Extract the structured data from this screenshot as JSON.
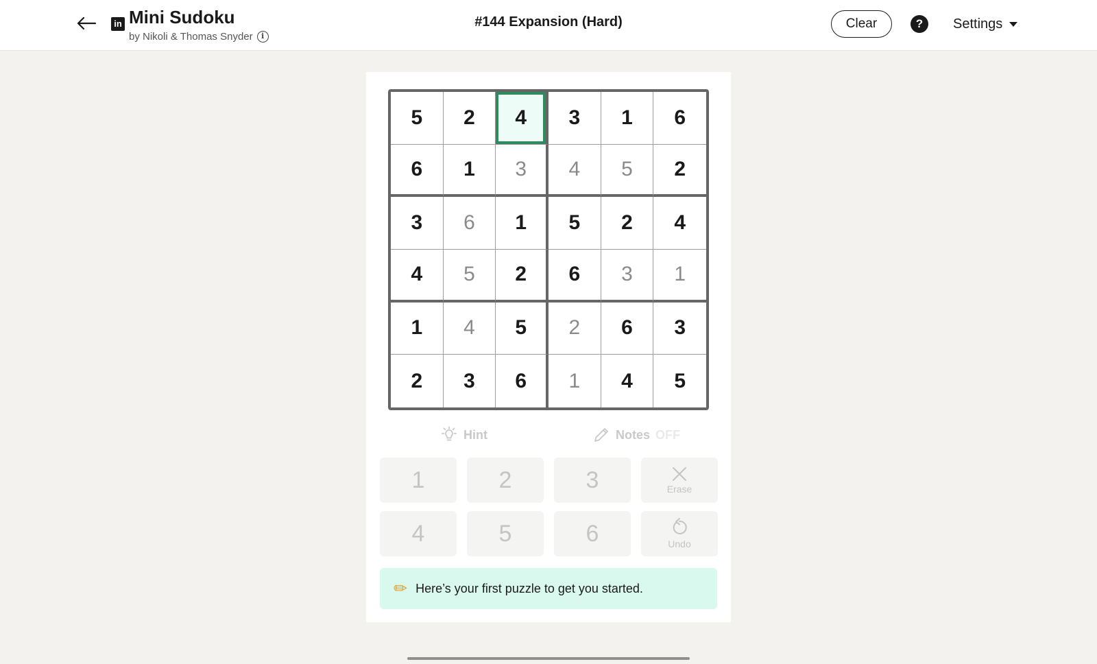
{
  "header": {
    "app_title": "Mini Sudoku",
    "byline": "by Nikoli & Thomas Snyder",
    "puzzle_title": "#144 Expansion (Hard)",
    "clear_label": "Clear",
    "help_label": "?",
    "settings_label": "Settings",
    "logo_text": "in",
    "info_label": "i"
  },
  "icons": {
    "back": "back-arrow-icon",
    "logo": "linkedin-logo-icon",
    "info": "info-icon",
    "help": "help-icon",
    "settings_caret": "chevron-down-icon",
    "hint": "lightbulb-icon",
    "notes": "pencil-icon",
    "erase": "close-icon",
    "undo": "undo-icon",
    "banner": "pencil-icon"
  },
  "board": {
    "selected": [
      0,
      2
    ],
    "rows": [
      [
        {
          "v": "5",
          "t": "given"
        },
        {
          "v": "2",
          "t": "given"
        },
        {
          "v": "4",
          "t": "given"
        },
        {
          "v": "3",
          "t": "given"
        },
        {
          "v": "1",
          "t": "given"
        },
        {
          "v": "6",
          "t": "given"
        }
      ],
      [
        {
          "v": "6",
          "t": "given"
        },
        {
          "v": "1",
          "t": "given"
        },
        {
          "v": "3",
          "t": "entered"
        },
        {
          "v": "4",
          "t": "entered"
        },
        {
          "v": "5",
          "t": "entered"
        },
        {
          "v": "2",
          "t": "given"
        }
      ],
      [
        {
          "v": "3",
          "t": "given"
        },
        {
          "v": "6",
          "t": "entered"
        },
        {
          "v": "1",
          "t": "given"
        },
        {
          "v": "5",
          "t": "given"
        },
        {
          "v": "2",
          "t": "given"
        },
        {
          "v": "4",
          "t": "given"
        }
      ],
      [
        {
          "v": "4",
          "t": "given"
        },
        {
          "v": "5",
          "t": "entered"
        },
        {
          "v": "2",
          "t": "given"
        },
        {
          "v": "6",
          "t": "given"
        },
        {
          "v": "3",
          "t": "entered"
        },
        {
          "v": "1",
          "t": "entered"
        }
      ],
      [
        {
          "v": "1",
          "t": "given"
        },
        {
          "v": "4",
          "t": "entered"
        },
        {
          "v": "5",
          "t": "given"
        },
        {
          "v": "2",
          "t": "entered"
        },
        {
          "v": "6",
          "t": "given"
        },
        {
          "v": "3",
          "t": "given"
        }
      ],
      [
        {
          "v": "2",
          "t": "given"
        },
        {
          "v": "3",
          "t": "given"
        },
        {
          "v": "6",
          "t": "given"
        },
        {
          "v": "1",
          "t": "entered"
        },
        {
          "v": "4",
          "t": "given"
        },
        {
          "v": "5",
          "t": "given"
        }
      ]
    ]
  },
  "tools": {
    "hint_label": "Hint",
    "notes_label": "Notes",
    "notes_state": "OFF"
  },
  "keypad": {
    "row1": [
      "1",
      "2",
      "3"
    ],
    "row2": [
      "4",
      "5",
      "6"
    ],
    "erase_label": "Erase",
    "undo_label": "Undo"
  },
  "banner": {
    "text": "Here’s your first puzzle to get you started."
  },
  "colors": {
    "selected_border": "#2e8b5f",
    "selected_fill": "#eefcf7",
    "banner_bg": "#d9f8ee",
    "page_bg": "#f3f2ef"
  }
}
